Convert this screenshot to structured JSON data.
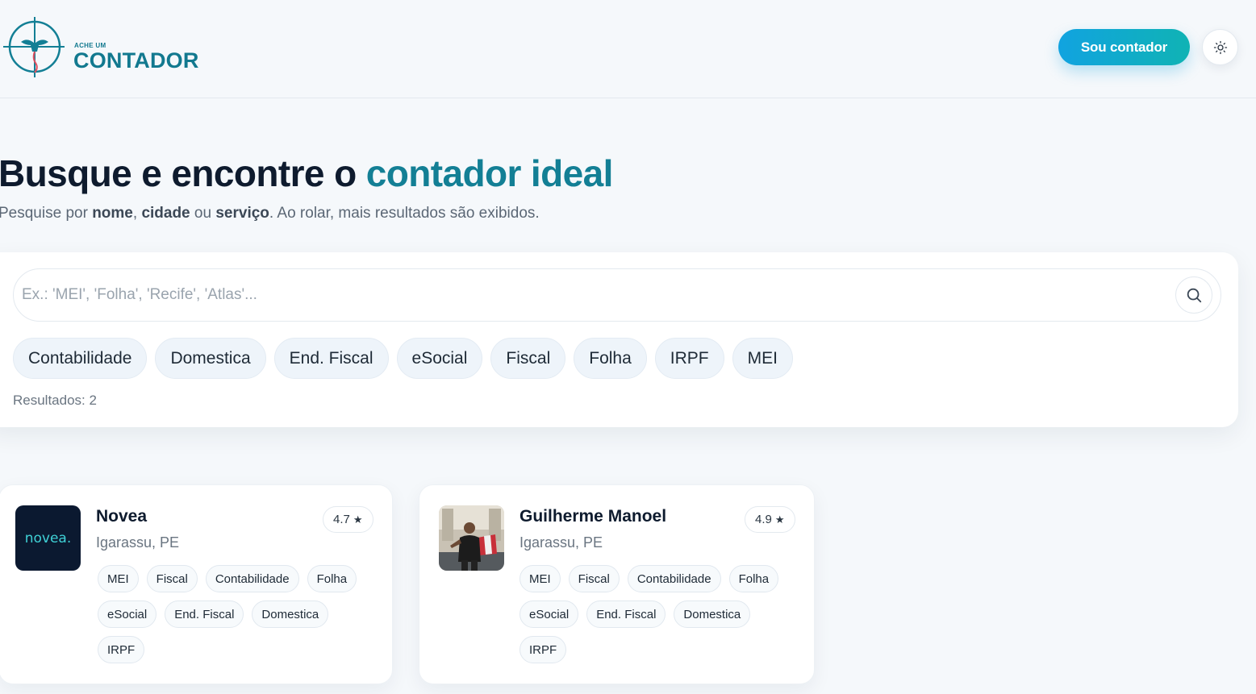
{
  "header": {
    "logo_small": "ACHE UM",
    "logo_big": "CONTADOR",
    "cta_label": "Sou contador",
    "theme_icon": "sun-icon"
  },
  "hero": {
    "title_main": "Busque e encontre o",
    "title_accent": "contador ideal",
    "sub_prefix": "Pesquise por",
    "sub_nome": "nome",
    "sub_comma": ",",
    "sub_cidade": "cidade",
    "sub_ou": "ou",
    "sub_servico": "serviço",
    "sub_suffix": ". Ao rolar, mais resultados são exibidos."
  },
  "search": {
    "placeholder": "Ex.: 'MEI', 'Folha', 'Recife', 'Atlas'...",
    "value": "",
    "icon": "search-icon",
    "chips": [
      "Contabilidade",
      "Domestica",
      "End. Fiscal",
      "eSocial",
      "Fiscal",
      "Folha",
      "IRPF",
      "MEI"
    ],
    "results_text": "Resultados: 2"
  },
  "results": [
    {
      "name": "Novea",
      "city": "Igarassu, PE",
      "rating": "4.7",
      "avatar_text": "novea.",
      "tags": [
        "MEI",
        "Fiscal",
        "Contabilidade",
        "Folha",
        "eSocial",
        "End. Fiscal",
        "Domestica",
        "IRPF"
      ]
    },
    {
      "name": "Guilherme Manoel",
      "city": "Igarassu, PE",
      "rating": "4.9",
      "tags": [
        "MEI",
        "Fiscal",
        "Contabilidade",
        "Folha",
        "eSocial",
        "End. Fiscal",
        "Domestica",
        "IRPF"
      ]
    }
  ],
  "colors": {
    "accent": "#137f95",
    "cta_start": "#11a3e0",
    "cta_end": "#10b3b4",
    "background": "#f5f8fb"
  }
}
